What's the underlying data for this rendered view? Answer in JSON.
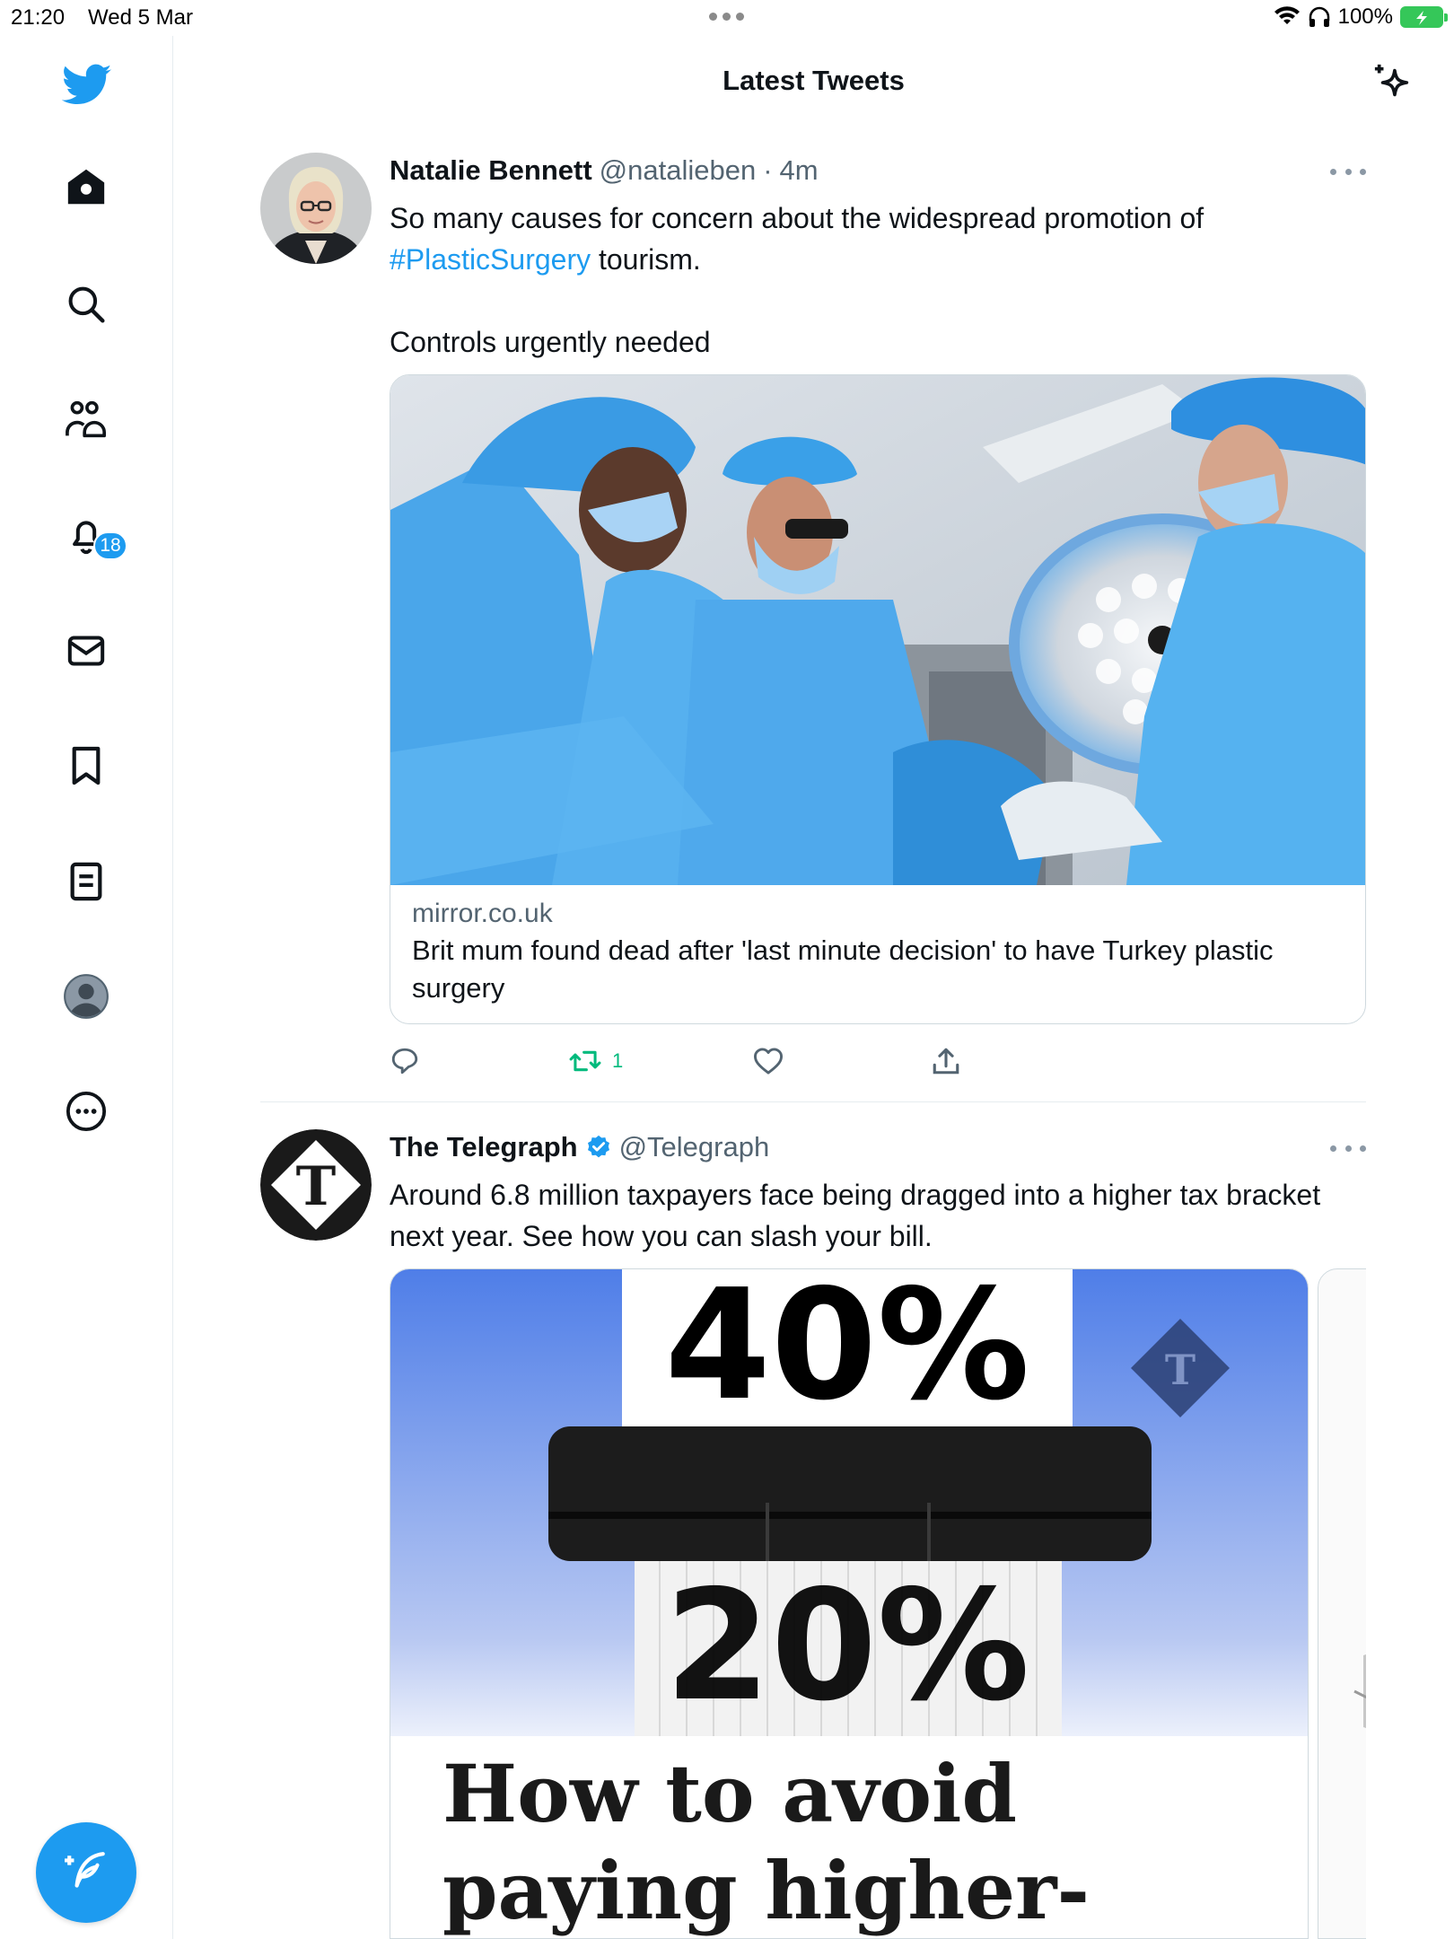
{
  "status_bar": {
    "time": "21:20",
    "date": "Wed 5 Mar",
    "battery": "100%"
  },
  "header": {
    "title": "Latest Tweets"
  },
  "sidebar": {
    "items": [
      {
        "icon": "home-icon"
      },
      {
        "icon": "search-icon"
      },
      {
        "icon": "communities-icon"
      },
      {
        "icon": "notifications-icon",
        "badge": "18"
      },
      {
        "icon": "messages-icon"
      },
      {
        "icon": "bookmark-icon"
      },
      {
        "icon": "lists-icon"
      },
      {
        "icon": "profile-icon"
      },
      {
        "icon": "more-icon"
      }
    ],
    "compose_icon": "compose-icon"
  },
  "tweets": [
    {
      "author": "Natalie Bennett",
      "handle": "@natalieben",
      "separator": "·",
      "time": "4m",
      "text_before": "So many causes for concern about the widespread promotion of",
      "hashtag": "#PlasticSurgery",
      "text_after": "tourism.",
      "text_line3": "Controls urgently needed",
      "card": {
        "domain": "mirror.co.uk",
        "title": "Brit mum found dead after 'last minute decision' to have Turkey plastic surgery"
      },
      "retweets": "1"
    },
    {
      "author": "The Telegraph",
      "handle": "@Telegraph",
      "verified": true,
      "text": "Around 6.8 million taxpayers face being dragged into a higher tax bracket next year. See how you can slash your bill.",
      "image": {
        "top_pct": "40%",
        "bottom_pct": "20%",
        "headline_line1": "How to avoid",
        "headline_line2": "paying higher-rate"
      }
    }
  ],
  "colors": {
    "accent": "#1d9bf0",
    "retweet_green": "#00ba7c",
    "text": "#0f1419",
    "muted": "#536471"
  }
}
